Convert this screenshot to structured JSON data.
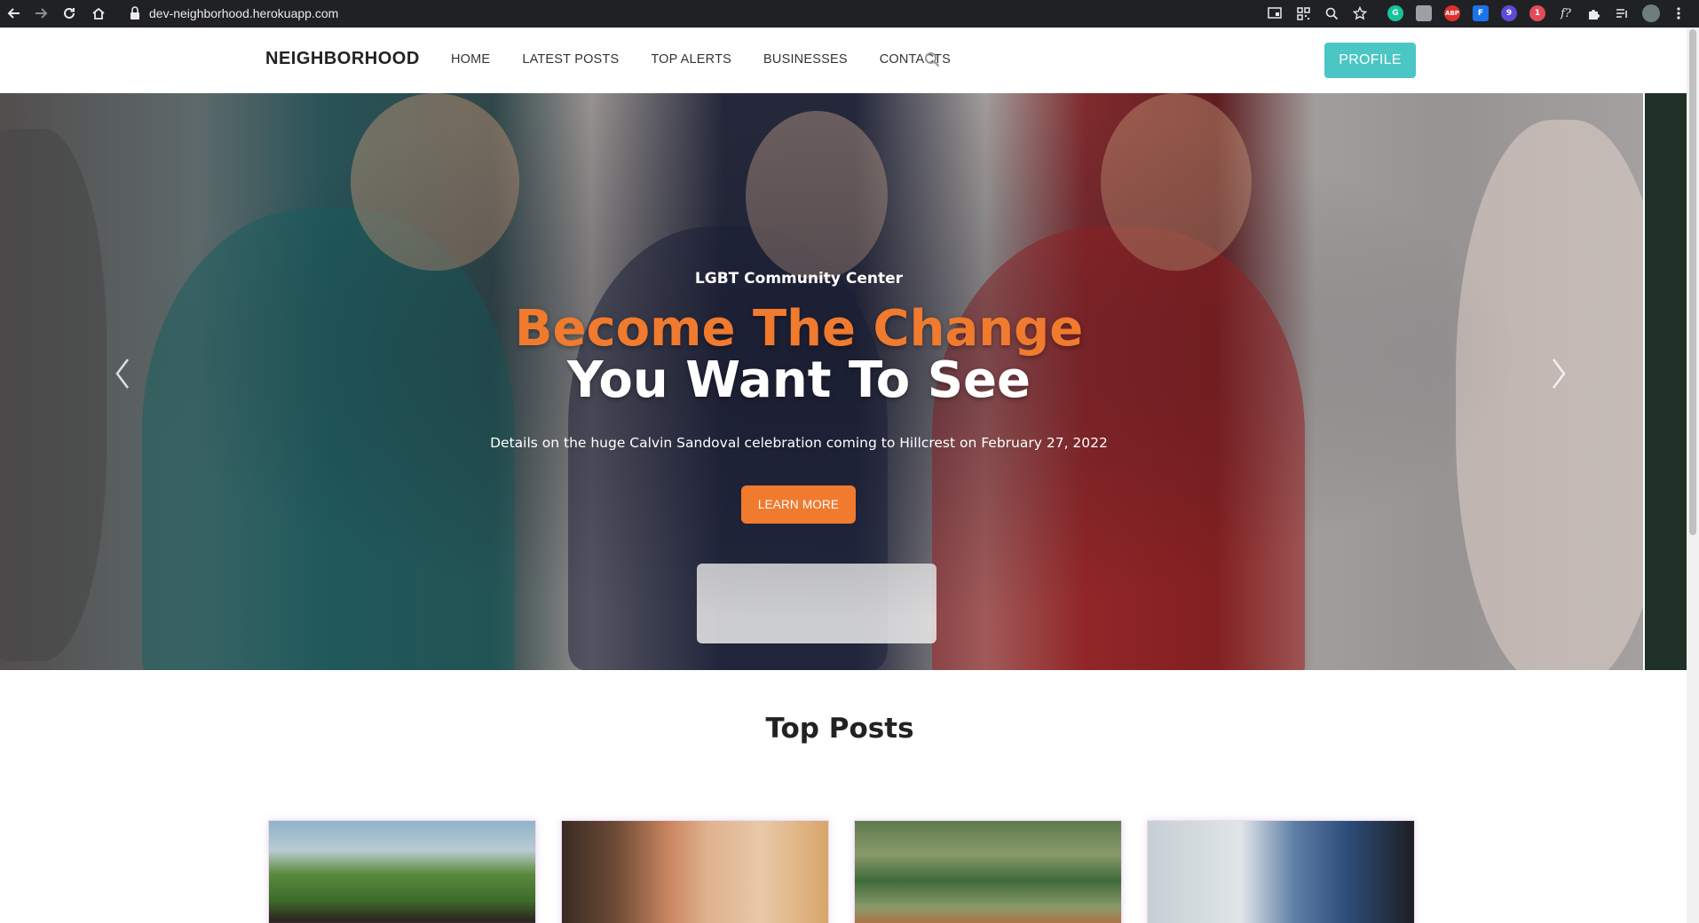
{
  "browser": {
    "url": "dev-neighborhood.herokuapp.com",
    "extensions": [
      {
        "icon": "cast-icon"
      },
      {
        "icon": "qr-icon"
      },
      {
        "icon": "zoom-icon"
      },
      {
        "icon": "star-icon"
      },
      {
        "icon": "grammarly-icon",
        "color": "#15c39a"
      },
      {
        "icon": "extension-gray-icon",
        "color": "#9aa0a6"
      },
      {
        "icon": "adblock-icon",
        "color": "#e0312b",
        "label": "ABP"
      },
      {
        "icon": "extension-blue-icon",
        "color": "#1a73e8",
        "label": "F"
      },
      {
        "icon": "extension-purple-icon",
        "color": "#5f4bd8",
        "badge": "9"
      },
      {
        "icon": "extension-badge-icon",
        "color": "#e34b5a",
        "badge": "1"
      },
      {
        "icon": "function-icon",
        "label": "f?"
      },
      {
        "icon": "puzzle-icon"
      },
      {
        "icon": "playlist-icon"
      },
      {
        "icon": "avatar"
      },
      {
        "icon": "kebab-icon"
      }
    ]
  },
  "navbar": {
    "brand": "NEIGHBORHOOD",
    "items": [
      "HOME",
      "LATEST POSTS",
      "TOP ALERTS",
      "BUSINESSES",
      "CONTACTS"
    ],
    "profile_label": "PROFILE",
    "accent": "#4ac7c4"
  },
  "hero": {
    "subtitle": "LGBT Community Center",
    "title_line1": "Become The Change",
    "title_line2": "You Want To See",
    "description": "Details on the huge Calvin Sandoval celebration coming to Hillcrest on February 27, 2022",
    "cta_label": "LEARN MORE",
    "accent": "#f07a2e",
    "slide_count": 3,
    "active_slide": 1
  },
  "top_posts": {
    "title": "Top Posts",
    "cards": [
      {
        "image": "children-playing"
      },
      {
        "image": "schoolgirls"
      },
      {
        "image": "garbage-truck"
      },
      {
        "image": "handshake"
      }
    ]
  }
}
